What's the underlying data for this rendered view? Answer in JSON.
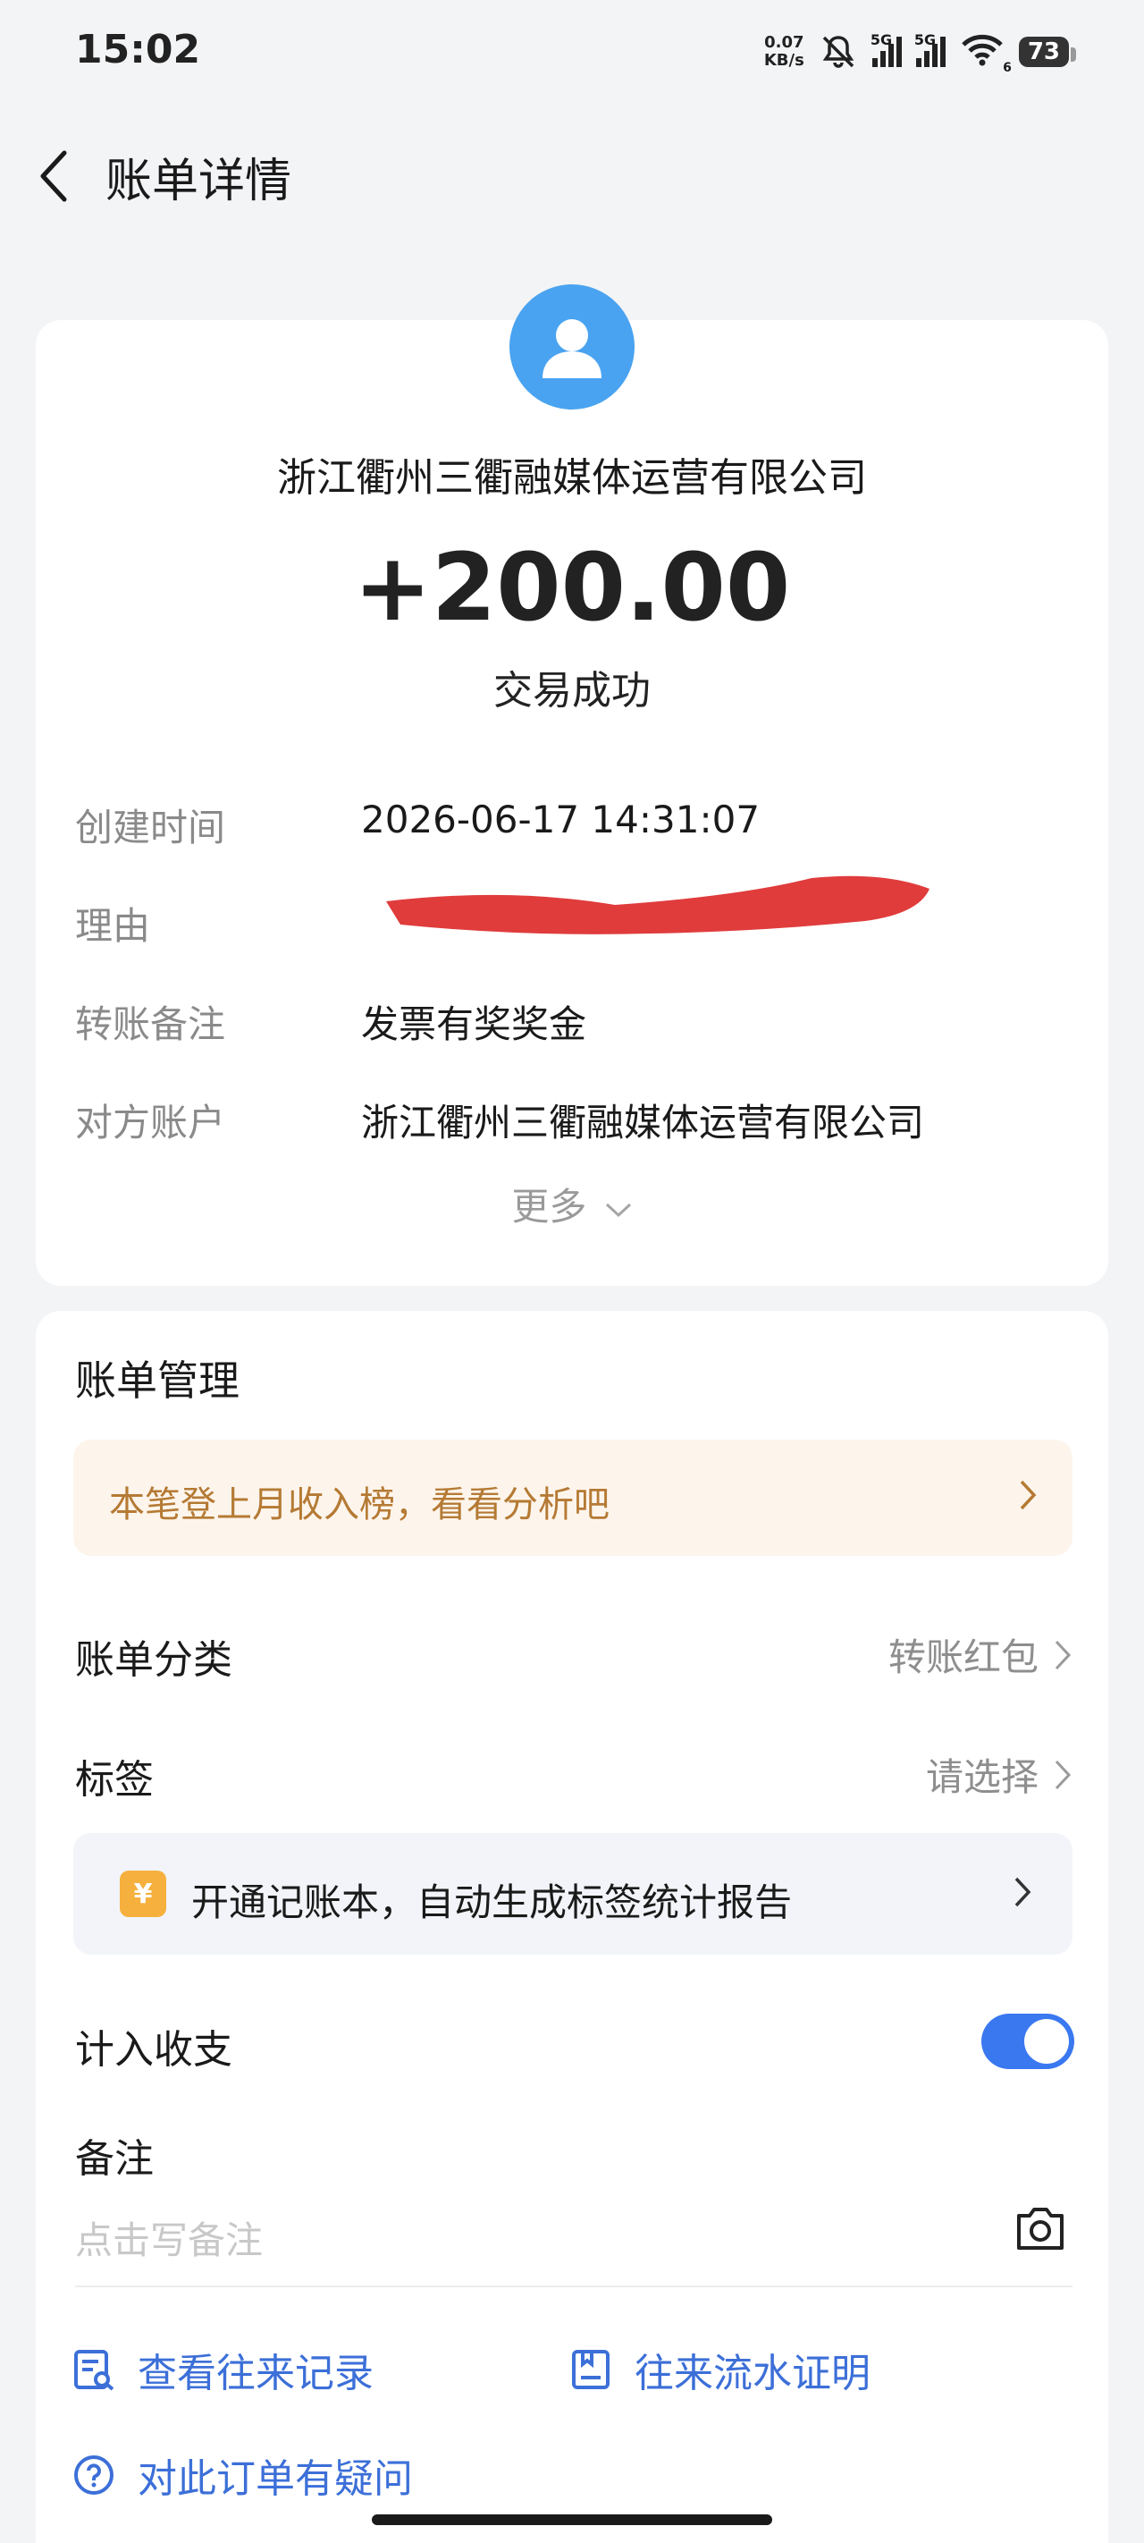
{
  "status_bar": {
    "time": "15:02",
    "net_speed_value": "0.07",
    "net_speed_unit": "KB/s",
    "signal1": "5G",
    "signal2": "5G",
    "wifi_sub": "6",
    "battery": "73"
  },
  "header": {
    "title": "账单详情",
    "back_icon": "chevron-left-icon"
  },
  "summary": {
    "avatar_icon": "user-avatar-icon",
    "payee": "浙江衢州三衢融媒体运营有限公司",
    "amount": "+200.00",
    "status": "交易成功"
  },
  "details": {
    "rows": [
      {
        "label": "创建时间",
        "value": "2026-06-17 14:31:07"
      },
      {
        "label": "理由",
        "value": ""
      },
      {
        "label": "转账备注",
        "value": "发票有奖奖金"
      },
      {
        "label": "对方账户",
        "value": "浙江衢州三衢融媒体运营有限公司"
      }
    ],
    "more_label": "更多"
  },
  "management": {
    "title": "账单管理",
    "promo_text": "本笔登上月收入榜，看看分析吧",
    "category_label": "账单分类",
    "category_value": "转账红包",
    "tag_label": "标签",
    "tag_value": "请选择",
    "ledger_icon_glyph": "¥",
    "ledger_text": "开通记账本，自动生成标签统计报告",
    "income_toggle_label": "计入收支",
    "income_toggle_on": true,
    "remark_label": "备注",
    "remark_placeholder": "点击写备注"
  },
  "links": {
    "records": "查看往来记录",
    "proof": "往来流水证明",
    "question": "对此订单有疑问"
  },
  "colors": {
    "accent": "#3a78f0",
    "link": "#3c6fd8",
    "promo_text": "#b57a34",
    "avatar": "#4aa3f0",
    "redaction": "#e03c3c"
  }
}
